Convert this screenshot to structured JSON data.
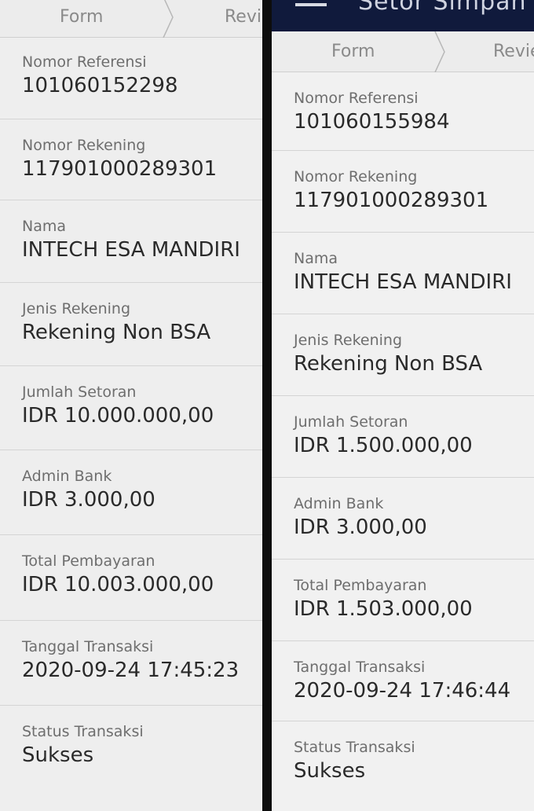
{
  "left": {
    "steps": {
      "form": "Form",
      "review": "Revi"
    },
    "fields": [
      {
        "label": "Nomor Referensi",
        "value": "101060152298"
      },
      {
        "label": "Nomor Rekening",
        "value": "117901000289301"
      },
      {
        "label": "Nama",
        "value": "INTECH ESA MANDIRI"
      },
      {
        "label": "Jenis Rekening",
        "value": "Rekening Non BSA"
      },
      {
        "label": "Jumlah Setoran",
        "value": "IDR 10.000.000,00"
      },
      {
        "label": "Admin Bank",
        "value": "IDR 3.000,00"
      },
      {
        "label": "Total Pembayaran",
        "value": "IDR 10.003.000,00"
      },
      {
        "label": "Tanggal Transaksi",
        "value": "2020-09-24 17:45:23"
      },
      {
        "label": "Status Transaksi",
        "value": "Sukses"
      }
    ]
  },
  "right": {
    "appbar": {
      "title": "Setor Simpan",
      "menu_icon": "hamburger-menu-icon"
    },
    "steps": {
      "form": "Form",
      "review": "Revie"
    },
    "fields": [
      {
        "label": "Nomor Referensi",
        "value": "101060155984"
      },
      {
        "label": "Nomor Rekening",
        "value": "117901000289301"
      },
      {
        "label": "Nama",
        "value": "INTECH ESA MANDIRI"
      },
      {
        "label": "Jenis Rekening",
        "value": "Rekening Non BSA"
      },
      {
        "label": "Jumlah Setoran",
        "value": "IDR 1.500.000,00"
      },
      {
        "label": "Admin Bank",
        "value": "IDR 3.000,00"
      },
      {
        "label": "Total Pembayaran",
        "value": "IDR 1.503.000,00"
      },
      {
        "label": "Tanggal Transaksi",
        "value": "2020-09-24 17:46:44"
      },
      {
        "label": "Status Transaksi",
        "value": "Sukses"
      }
    ]
  },
  "colors": {
    "appbar": "#101a3c",
    "panel_bg": "#eeeeee",
    "label": "#6e6e6e",
    "value": "#2a2a2a"
  }
}
